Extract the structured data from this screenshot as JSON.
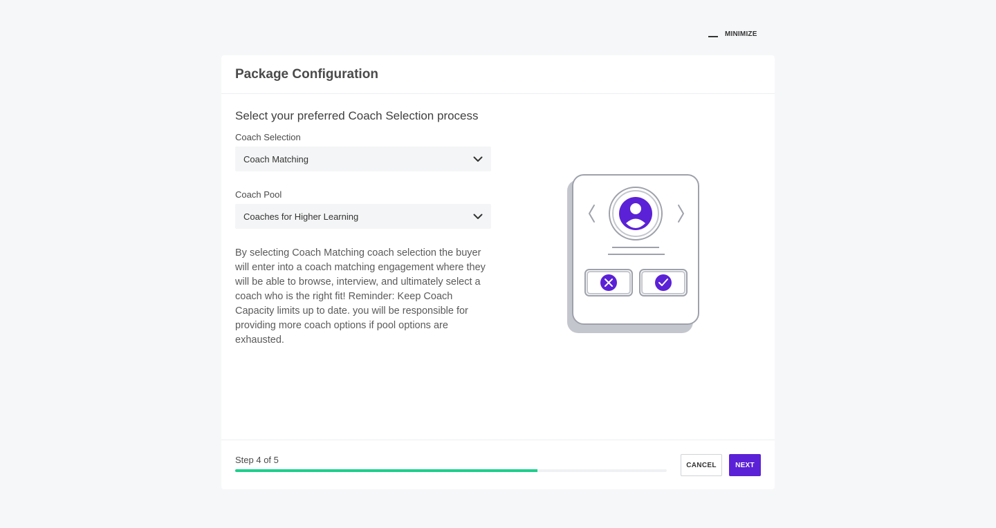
{
  "minimize": {
    "label": "MINIMIZE",
    "icon": "minus-icon"
  },
  "header": {
    "title": "Package Configuration"
  },
  "main": {
    "section_title": "Select your preferred Coach Selection process",
    "coach_selection": {
      "label": "Coach Selection",
      "value": "Coach Matching"
    },
    "coach_pool": {
      "label": "Coaches for Higher Learning",
      "field_label": "Coach Pool"
    },
    "description": "By selecting Coach Matching coach selection the buyer will enter into a coach matching engagement where they will be able to browse, interview, and ultimately select a coach who is the right fit! Reminder: Keep Coach Capacity limits up to date. you will be responsible for providing more coach options if pool options are exhausted."
  },
  "footer": {
    "step_text": "Step 4 of 5",
    "progress_fraction": 0.7,
    "cancel_label": "CANCEL",
    "next_label": "NEXT"
  },
  "colors": {
    "accent": "#5b21d6",
    "progress": "#1dcf8c",
    "background": "#f6f7f9"
  }
}
